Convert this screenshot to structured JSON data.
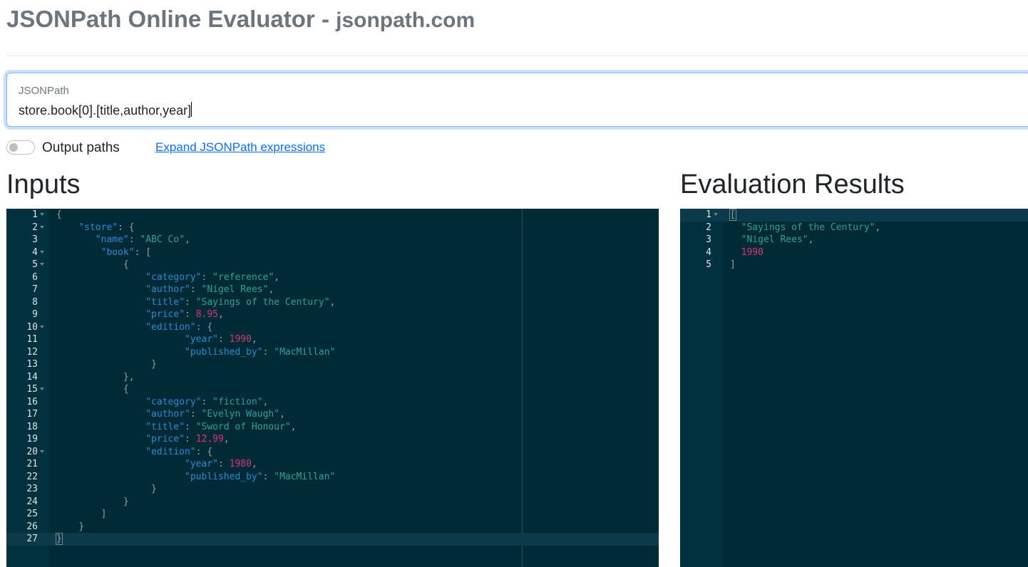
{
  "header": {
    "title": "JSONPath Online Evaluator",
    "separator": " - ",
    "subtitle": "jsonpath.com"
  },
  "jsonpath": {
    "label": "JSONPath",
    "value": "store.book[0].[title,author,year]"
  },
  "options": {
    "output_paths_label": "Output paths",
    "output_paths_enabled": false,
    "expand_link": "Expand JSONPath expressions"
  },
  "inputs": {
    "heading": "Inputs",
    "lines": [
      [
        [
          "pun",
          "{"
        ]
      ],
      [
        [
          "pun",
          "    "
        ],
        [
          "key",
          "\"store\""
        ],
        [
          "pun",
          ": {"
        ]
      ],
      [
        [
          "pun",
          "       "
        ],
        [
          "key",
          "\"name\""
        ],
        [
          "pun",
          ": "
        ],
        [
          "str",
          "\"ABC Co\""
        ],
        [
          "pun",
          ","
        ]
      ],
      [
        [
          "pun",
          "        "
        ],
        [
          "key",
          "\"book\""
        ],
        [
          "pun",
          ": ["
        ]
      ],
      [
        [
          "pun",
          "            {"
        ]
      ],
      [
        [
          "pun",
          "                "
        ],
        [
          "key",
          "\"category\""
        ],
        [
          "pun",
          ": "
        ],
        [
          "str",
          "\"reference\""
        ],
        [
          "pun",
          ","
        ]
      ],
      [
        [
          "pun",
          "                "
        ],
        [
          "key",
          "\"author\""
        ],
        [
          "pun",
          ": "
        ],
        [
          "str",
          "\"Nigel Rees\""
        ],
        [
          "pun",
          ","
        ]
      ],
      [
        [
          "pun",
          "                "
        ],
        [
          "key",
          "\"title\""
        ],
        [
          "pun",
          ": "
        ],
        [
          "str",
          "\"Sayings of the Century\""
        ],
        [
          "pun",
          ","
        ]
      ],
      [
        [
          "pun",
          "                "
        ],
        [
          "key",
          "\"price\""
        ],
        [
          "pun",
          ": "
        ],
        [
          "num",
          "8.95"
        ],
        [
          "pun",
          ","
        ]
      ],
      [
        [
          "pun",
          "                "
        ],
        [
          "key",
          "\"edition\""
        ],
        [
          "pun",
          ": {"
        ]
      ],
      [
        [
          "pun",
          "                       "
        ],
        [
          "key",
          "\"year\""
        ],
        [
          "pun",
          ": "
        ],
        [
          "num",
          "1990"
        ],
        [
          "pun",
          ","
        ]
      ],
      [
        [
          "pun",
          "                       "
        ],
        [
          "key",
          "\"published_by\""
        ],
        [
          "pun",
          ": "
        ],
        [
          "str",
          "\"MacMillan\""
        ]
      ],
      [
        [
          "pun",
          "                 }"
        ]
      ],
      [
        [
          "pun",
          "            },"
        ]
      ],
      [
        [
          "pun",
          "            {"
        ]
      ],
      [
        [
          "pun",
          "                "
        ],
        [
          "key",
          "\"category\""
        ],
        [
          "pun",
          ": "
        ],
        [
          "str",
          "\"fiction\""
        ],
        [
          "pun",
          ","
        ]
      ],
      [
        [
          "pun",
          "                "
        ],
        [
          "key",
          "\"author\""
        ],
        [
          "pun",
          ": "
        ],
        [
          "str",
          "\"Evelyn Waugh\""
        ],
        [
          "pun",
          ","
        ]
      ],
      [
        [
          "pun",
          "                "
        ],
        [
          "key",
          "\"title\""
        ],
        [
          "pun",
          ": "
        ],
        [
          "str",
          "\"Sword of Honour\""
        ],
        [
          "pun",
          ","
        ]
      ],
      [
        [
          "pun",
          "                "
        ],
        [
          "key",
          "\"price\""
        ],
        [
          "pun",
          ": "
        ],
        [
          "num",
          "12.99"
        ],
        [
          "pun",
          ","
        ]
      ],
      [
        [
          "pun",
          "                "
        ],
        [
          "key",
          "\"edition\""
        ],
        [
          "pun",
          ": {"
        ]
      ],
      [
        [
          "pun",
          "                       "
        ],
        [
          "key",
          "\"year\""
        ],
        [
          "pun",
          ": "
        ],
        [
          "num",
          "1980"
        ],
        [
          "pun",
          ","
        ]
      ],
      [
        [
          "pun",
          "                       "
        ],
        [
          "key",
          "\"published_by\""
        ],
        [
          "pun",
          ": "
        ],
        [
          "str",
          "\"MacMillan\""
        ]
      ],
      [
        [
          "pun",
          "                 }"
        ]
      ],
      [
        [
          "pun",
          "            }"
        ]
      ],
      [
        [
          "pun",
          "        ]"
        ]
      ],
      [
        [
          "pun",
          "    }"
        ]
      ],
      [
        [
          "pun",
          "}"
        ]
      ]
    ],
    "fold_lines": [
      1,
      2,
      4,
      5,
      10,
      15,
      20
    ],
    "active_line": 27
  },
  "results": {
    "heading": "Evaluation Results",
    "lines": [
      [
        [
          "pun",
          "["
        ]
      ],
      [
        [
          "pun",
          "  "
        ],
        [
          "str",
          "\"Sayings of the Century\""
        ],
        [
          "pun",
          ","
        ]
      ],
      [
        [
          "pun",
          "  "
        ],
        [
          "str",
          "\"Nigel Rees\""
        ],
        [
          "pun",
          ","
        ]
      ],
      [
        [
          "pun",
          "  "
        ],
        [
          "num",
          "1990"
        ]
      ],
      [
        [
          "pun",
          "]"
        ]
      ]
    ],
    "fold_lines": [
      1
    ],
    "active_line": 1
  }
}
